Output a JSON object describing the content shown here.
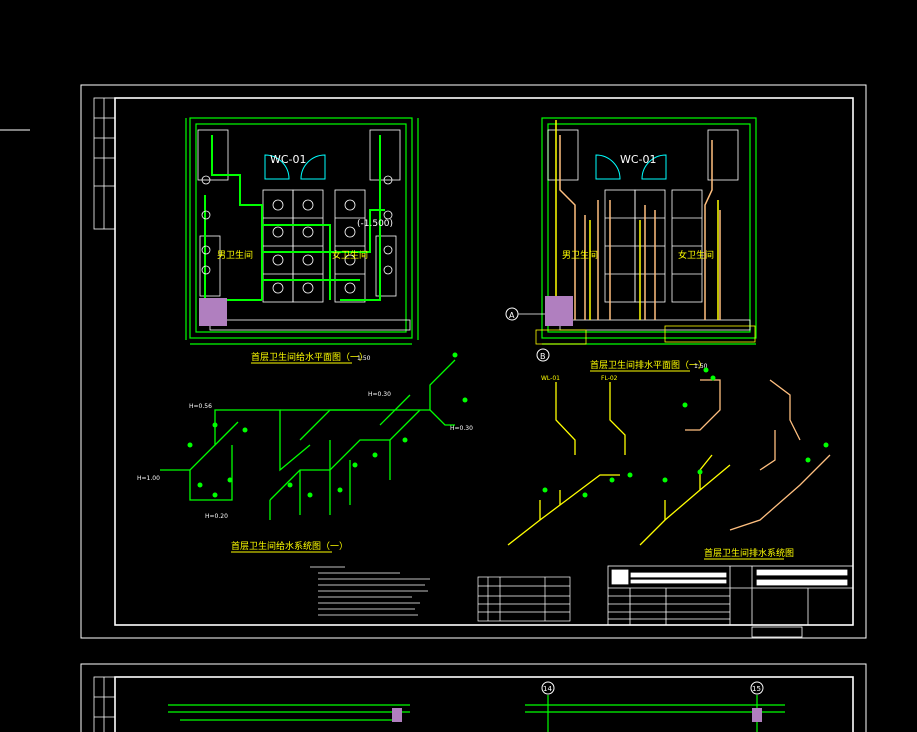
{
  "colors": {
    "background": "#000000",
    "frame": "#ffffff",
    "water_supply": "#00ff00",
    "drainage": "#ffff00",
    "vent": "#ffbf7f",
    "wall": "#00ff00",
    "fixture": "#ffffff",
    "door": "#00ffff",
    "fill": "#b07fbf"
  },
  "drawing_text": {
    "supply_plan_title": "首层卫生间给水平面图（一）",
    "drainage_plan_title": "首层卫生间排水平面图（一）",
    "supply_system_title": "首层卫生间给水系统图（一）",
    "drainage_system_title": "首层卫生间排水系统图",
    "scale": "1:50",
    "room_code": "WC-01",
    "male_toilet": "男卫生间",
    "female_toilet": "女卫生间",
    "axis_a": "A",
    "axis_b": "B",
    "axis_14": "14",
    "axis_15": "15",
    "level_minus_500": "(-1.500)",
    "h_056": "H=0.56",
    "h_030": "H=0.30",
    "h_020": "H=0.20",
    "h_100": "H=1.00",
    "wl_01": "WL-01",
    "fl_02": "FL-02"
  }
}
